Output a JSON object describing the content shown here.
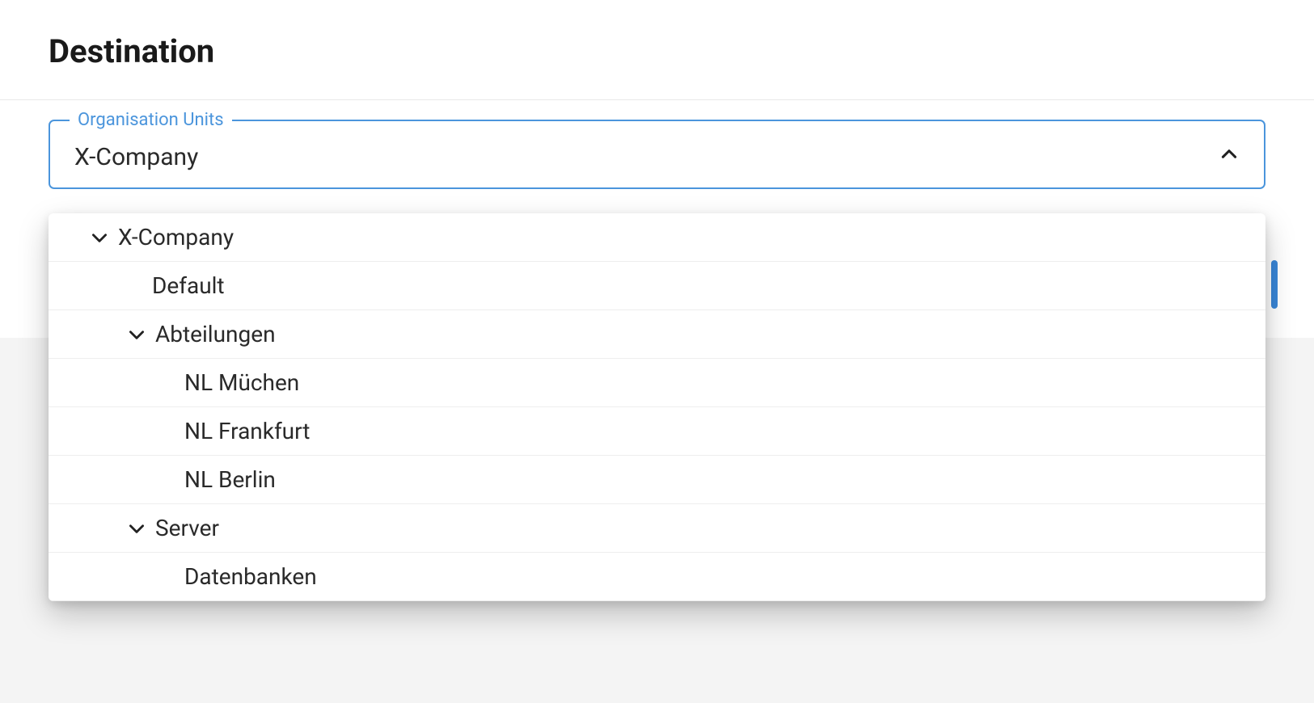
{
  "header": {
    "title": "Destination"
  },
  "select": {
    "legend": "Organisation Units",
    "value": "X-Company",
    "expanded": true
  },
  "colors": {
    "accent": "#4b95dc"
  },
  "tree": {
    "items": [
      {
        "label": "X-Company",
        "depth": 0,
        "expandable": true,
        "expanded": true
      },
      {
        "label": "Default",
        "depth": 1,
        "expandable": false,
        "expanded": false
      },
      {
        "label": "Abteilungen",
        "depth": 1,
        "expandable": true,
        "expanded": true
      },
      {
        "label": "NL Müchen",
        "depth": 2,
        "expandable": false,
        "expanded": false
      },
      {
        "label": "NL Frankfurt",
        "depth": 2,
        "expandable": false,
        "expanded": false
      },
      {
        "label": "NL Berlin",
        "depth": 2,
        "expandable": false,
        "expanded": false
      },
      {
        "label": "Server",
        "depth": 1,
        "expandable": true,
        "expanded": true
      },
      {
        "label": "Datenbanken",
        "depth": 2,
        "expandable": false,
        "expanded": false
      }
    ]
  }
}
